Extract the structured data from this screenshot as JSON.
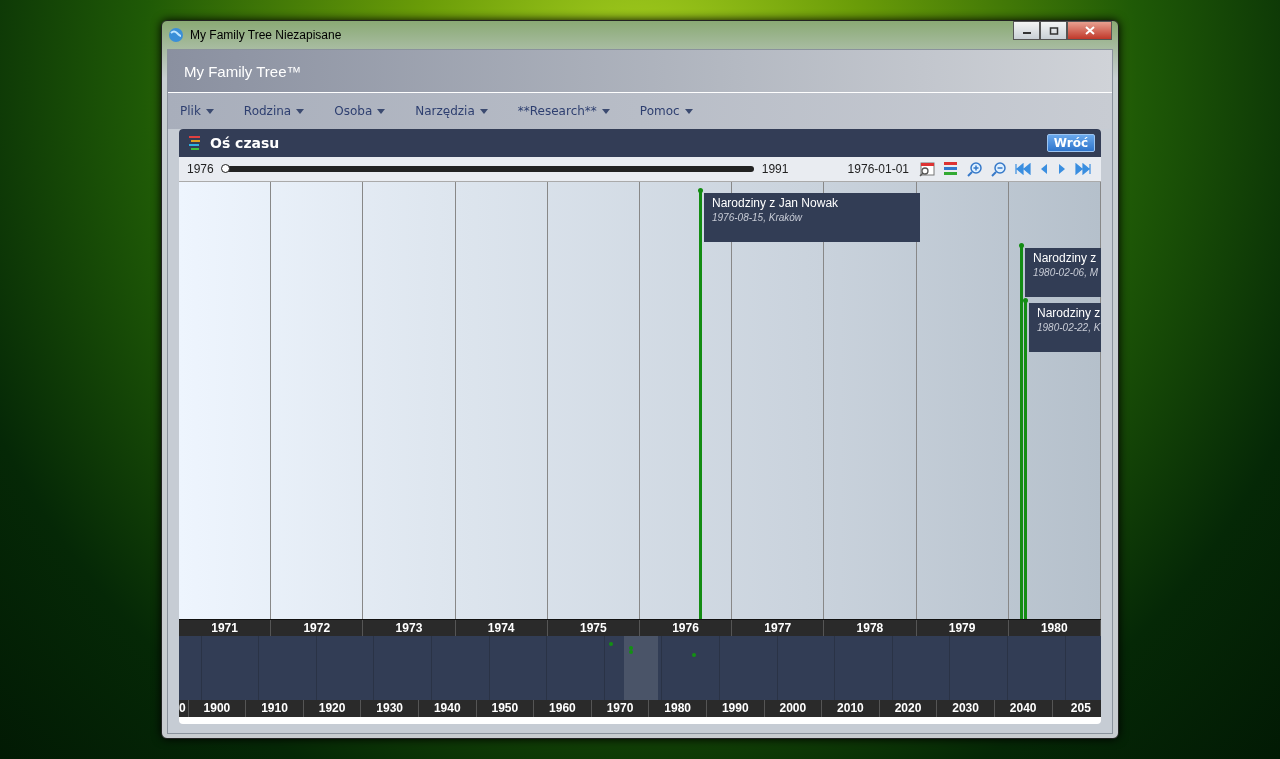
{
  "window": {
    "title": "My Family Tree Niezapisane"
  },
  "app_title": "My Family Tree™",
  "menu": [
    "Plik",
    "Rodzina",
    "Osoba",
    "Narzędzia",
    "**Research**",
    "Pomoc"
  ],
  "panel": {
    "title": "Oś czasu",
    "back_button": "Wróć"
  },
  "range": {
    "start": "1976",
    "end": "1991",
    "level": 0,
    "current_date": "1976-01-01"
  },
  "years": [
    "1971",
    "1972",
    "1973",
    "1974",
    "1975",
    "1976",
    "1977",
    "1978",
    "1979",
    "1980"
  ],
  "events": [
    {
      "title": "Narodziny z Jan Nowak",
      "detail": "1976-08-15, Kraków"
    },
    {
      "title": "Narodziny z",
      "detail": "1980-02-06, M"
    },
    {
      "title": "Narodziny z",
      "detail": "1980-02-22, K"
    }
  ],
  "decades": [
    "0",
    "1900",
    "1910",
    "1920",
    "1930",
    "1940",
    "1950",
    "1960",
    "1970",
    "1980",
    "1990",
    "2000",
    "2010",
    "2020",
    "2030",
    "2040",
    "205"
  ]
}
